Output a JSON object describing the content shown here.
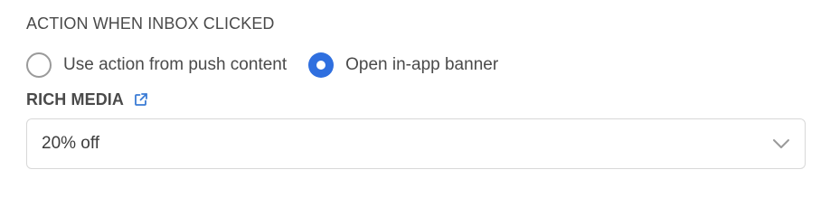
{
  "action_section": {
    "title": "ACTION WHEN INBOX CLICKED",
    "options": [
      {
        "label": "Use action from push content",
        "selected": false
      },
      {
        "label": "Open in-app banner",
        "selected": true
      }
    ]
  },
  "rich_media_section": {
    "title": "RICH MEDIA",
    "link_icon": "external-link-icon",
    "select": {
      "value": "20% off",
      "icon": "chevron-down-icon"
    }
  },
  "colors": {
    "accent": "#2f6fdf",
    "text": "#4a4a4a",
    "border": "#d8d8d8"
  }
}
